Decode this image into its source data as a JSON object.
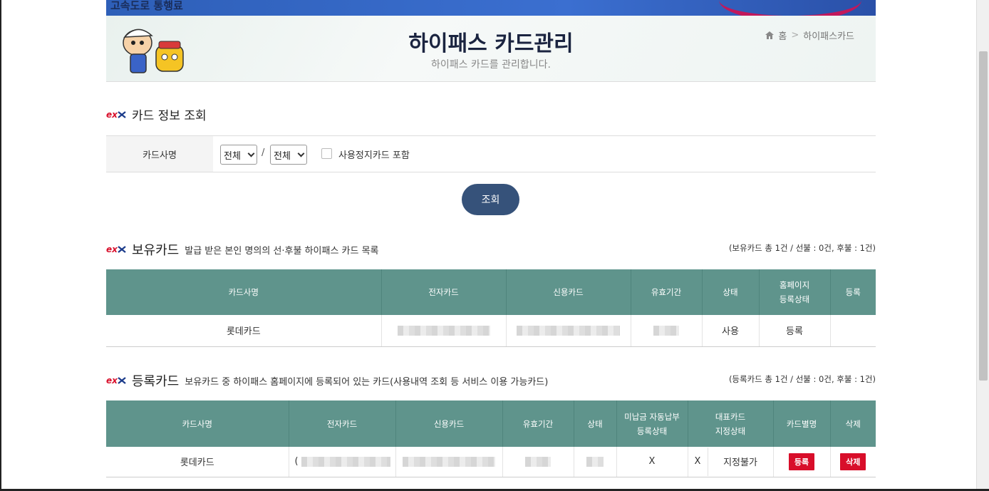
{
  "topbar": {
    "text": "고속도로 통행료"
  },
  "header": {
    "title": "하이패스 카드관리",
    "subtitle": "하이패스 카드를 관리합니다.",
    "breadcrumb": {
      "home": "홈",
      "separator": ">",
      "current": "하이패스카드"
    }
  },
  "search_section": {
    "title": "카드 정보 조회",
    "label": "카드사명",
    "select1": "전체",
    "slash": "/",
    "select2": "전체",
    "checkbox_label": "사용정지카드 포함",
    "button": "조회"
  },
  "owned_section": {
    "title": "보유카드",
    "desc": "발급 받은 본인 명의의 선·후불 하이패스 카드 목록",
    "counts": "(보유카드 총 1건 / 선불 : 0건, 후불 : 1건)",
    "headers": [
      "카드사명",
      "전자카드",
      "신용카드",
      "유효기간",
      "상태",
      "홈페이지\n등록상태",
      "등록"
    ],
    "rows": [
      {
        "card_company": "롯데카드",
        "status": "사용",
        "registration": "등록",
        "action": ""
      }
    ]
  },
  "registered_section": {
    "title": "등록카드",
    "desc": "보유카드 중 하이패스 홈페이지에 등록되어 있는 카드(사용내역 조회 등 서비스 이용 가능카드)",
    "counts": "(등록카드 총 1건 / 선불 : 0건, 후불 : 1건)",
    "headers": [
      "카드사명",
      "전자카드",
      "신용카드",
      "유효기간",
      "상태",
      "미납금 자동납부\n등록상태",
      "대표카드\n지정상태",
      "카드별명",
      "삭제"
    ],
    "rows": [
      {
        "card_company": "롯데카드",
        "electronic_prefix": "(",
        "autopay": "X",
        "rep_mark": "X",
        "rep_status": "지정불가",
        "alias_btn": "등록",
        "delete_btn": "삭제"
      }
    ]
  },
  "colors": {
    "header_bg": "#5f948c",
    "button_bg": "#36527a",
    "danger": "#d80e2a",
    "ex_logo": "#d80e2a"
  }
}
